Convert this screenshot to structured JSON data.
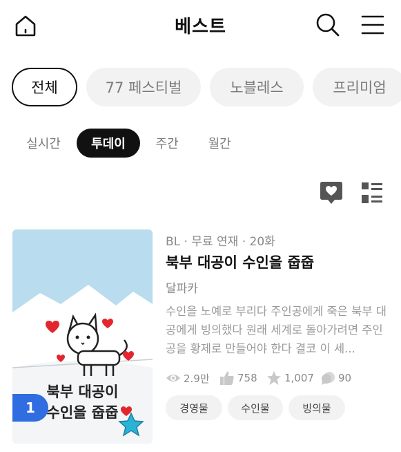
{
  "header": {
    "title": "베스트",
    "home_icon": "home-icon",
    "search_icon": "search-icon",
    "menu_icon": "hamburger-menu-icon"
  },
  "categories": [
    {
      "label": "전체",
      "active": true
    },
    {
      "label": "77 페스티벌",
      "active": false
    },
    {
      "label": "노블레스",
      "active": false
    },
    {
      "label": "프리미엄",
      "active": false
    }
  ],
  "periods": [
    {
      "label": "실시간",
      "active": false
    },
    {
      "label": "투데이",
      "active": true
    },
    {
      "label": "주간",
      "active": false
    },
    {
      "label": "월간",
      "active": false
    }
  ],
  "view_toggles": {
    "heart_icon": "heart-chat-icon",
    "list_icon": "list-view-icon"
  },
  "ranking": [
    {
      "rank": "1",
      "cover_title_line1": "북부 대공이",
      "cover_title_line2": "수인을 줍줍",
      "meta": "BL · 무료 연재 · 20화",
      "title": "북부 대공이 수인을 줍줍",
      "author": "달파카",
      "synopsis": "수인을 노예로 부리다 주인공에게 죽은 북부 대공에게 빙의했다 원래 세계로 돌아가려면 주인공을 황제로 만들어야 한다 결코 이 세...",
      "stats": {
        "views": "2.9만",
        "likes": "758",
        "stars": "1,007",
        "comments": "90"
      },
      "tags": [
        "경영물",
        "수인물",
        "빙의물"
      ],
      "colors": {
        "badge": "#2f6de0",
        "sky": "#b9dcee",
        "star": "#2bb3d6",
        "heart": "#e3262e"
      }
    }
  ]
}
